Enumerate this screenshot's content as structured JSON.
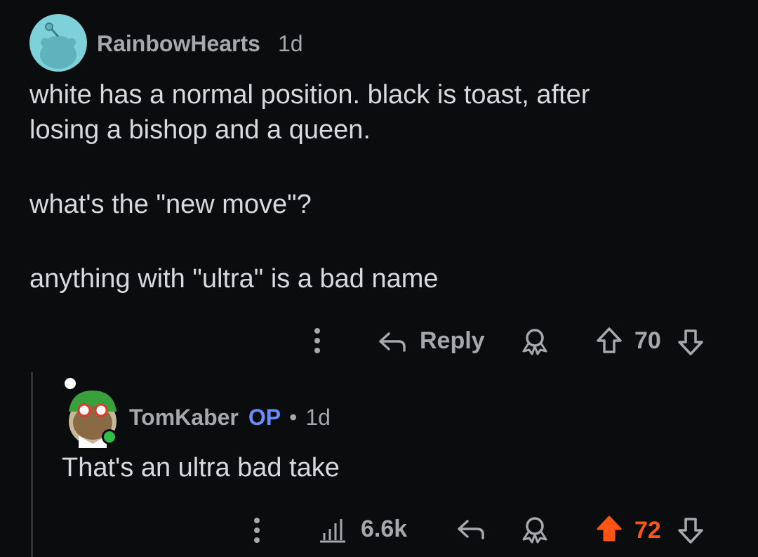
{
  "comment1": {
    "username": "RainbowHearts",
    "time": "1d",
    "lines": [
      "white has a normal position. black is toast, after",
      "losing a bishop and a queen.",
      "what's the \"new move\"?",
      "anything with \"ultra\" is a bad name"
    ],
    "actions": {
      "reply_label": "Reply",
      "score": "70"
    }
  },
  "comment2": {
    "username": "TomKaber",
    "op_badge": "OP",
    "separator": "•",
    "time": "1d",
    "text": "That's an ultra bad take",
    "actions": {
      "views": "6.6k",
      "score": "72"
    }
  },
  "icons": [
    "more-vertical-icon",
    "reply-arrow-icon",
    "award-icon",
    "upvote-icon",
    "downvote-icon",
    "stats-icon"
  ],
  "colors": {
    "background": "#0b0c0e",
    "text": "#d7dadc",
    "muted": "#a6a8ab",
    "op": "#6b8cff",
    "upvoted": "#ff5414",
    "avatar_bg": "#7fd1d9"
  }
}
